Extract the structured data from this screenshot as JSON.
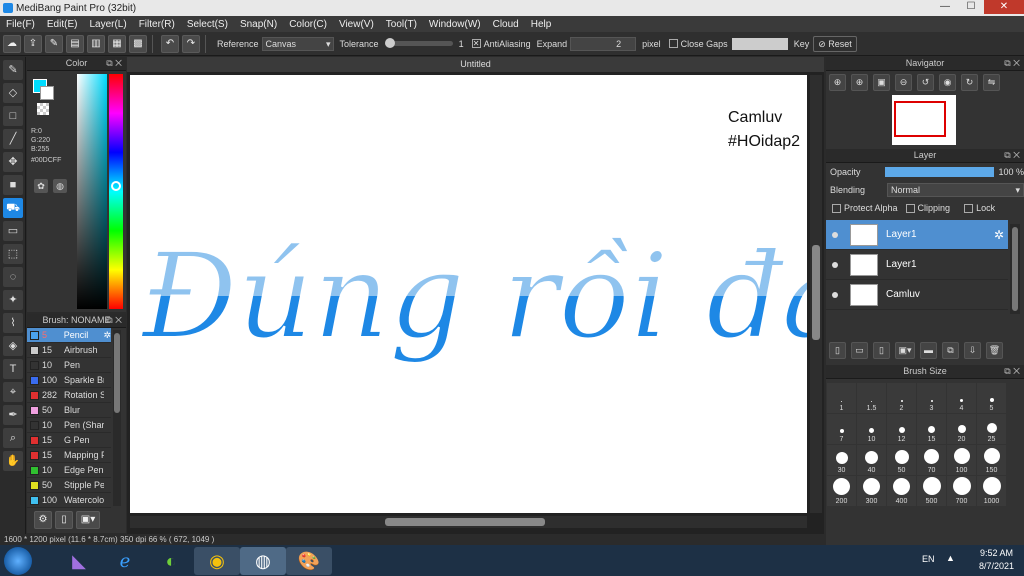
{
  "window": {
    "title": "MediBang Paint Pro (32bit)"
  },
  "menu": [
    "File(F)",
    "Edit(E)",
    "Layer(L)",
    "Filter(R)",
    "Select(S)",
    "Snap(N)",
    "Color(C)",
    "View(V)",
    "Tool(T)",
    "Window(W)",
    "Cloud",
    "Help"
  ],
  "toolbar": {
    "reference_label": "Reference",
    "reference_value": "Canvas",
    "tolerance_label": "Tolerance",
    "tolerance_value": "1",
    "antialiasing_label": "AntiAliasing",
    "expand_label": "Expand",
    "expand_value": "2",
    "expand_unit": "pixel",
    "close_gaps_label": "Close Gaps",
    "key_label": "Key",
    "reset_label": "Reset"
  },
  "color_panel": {
    "title": "Color",
    "r": "R:0",
    "g": "G:220",
    "b": "B:255",
    "hex": "#00DCFF",
    "fg": "#00DCFF"
  },
  "brush_panel": {
    "title": "Brush: NONAME",
    "items": [
      {
        "size": "5",
        "name": "Pencil",
        "color": "#4aa3f0",
        "selected": true
      },
      {
        "size": "15",
        "name": "Airbrush",
        "color": "#cccccc"
      },
      {
        "size": "10",
        "name": "Pen",
        "color": "#333333"
      },
      {
        "size": "100",
        "name": "Sparkle Br",
        "color": "#3a6cf0"
      },
      {
        "size": "282",
        "name": "Rotation S",
        "color": "#e03030"
      },
      {
        "size": "50",
        "name": "Blur",
        "color": "#f0a0e0"
      },
      {
        "size": "10",
        "name": "Pen (Shar",
        "color": "#333333"
      },
      {
        "size": "15",
        "name": "G Pen",
        "color": "#e03030"
      },
      {
        "size": "15",
        "name": "Mapping P",
        "color": "#e03030"
      },
      {
        "size": "10",
        "name": "Edge Pen",
        "color": "#30c030"
      },
      {
        "size": "50",
        "name": "Stipple Pe",
        "color": "#e0e020"
      },
      {
        "size": "100",
        "name": "Watercolo",
        "color": "#40c0f0"
      }
    ]
  },
  "document": {
    "tab_title": "Untitled"
  },
  "canvas_text": {
    "line1": "Camluv",
    "line2": "#HOidap2",
    "lettering": "Đúng rồi đấy"
  },
  "status": {
    "size": "1600 * 1200 pixel",
    "physical": "(11.6 * 8.7cm)",
    "dpi": "350 dpi",
    "zoom": "66 %",
    "coords": "( 672, 1049 )"
  },
  "navigator": {
    "title": "Navigator"
  },
  "layer_panel": {
    "title": "Layer",
    "opacity_label": "Opacity",
    "opacity_value": "100 %",
    "blending_label": "Blending",
    "blending_value": "Normal",
    "protect_alpha": "Protect Alpha",
    "clipping": "Clipping",
    "lock": "Lock",
    "layers": [
      {
        "name": "Layer1",
        "selected": true
      },
      {
        "name": "Layer1",
        "selected": false
      },
      {
        "name": "Camluv",
        "selected": false
      }
    ]
  },
  "brush_size_panel": {
    "title": "Brush Size",
    "sizes": [
      "1",
      "1.5",
      "2",
      "3",
      "4",
      "5",
      "7",
      "10",
      "12",
      "15",
      "20",
      "25",
      "30",
      "40",
      "50",
      "70",
      "100",
      "150",
      "200",
      "300",
      "400",
      "500",
      "700",
      "1000"
    ]
  },
  "taskbar": {
    "lang": "EN",
    "time": "9:52 AM",
    "date": "8/7/2021"
  }
}
